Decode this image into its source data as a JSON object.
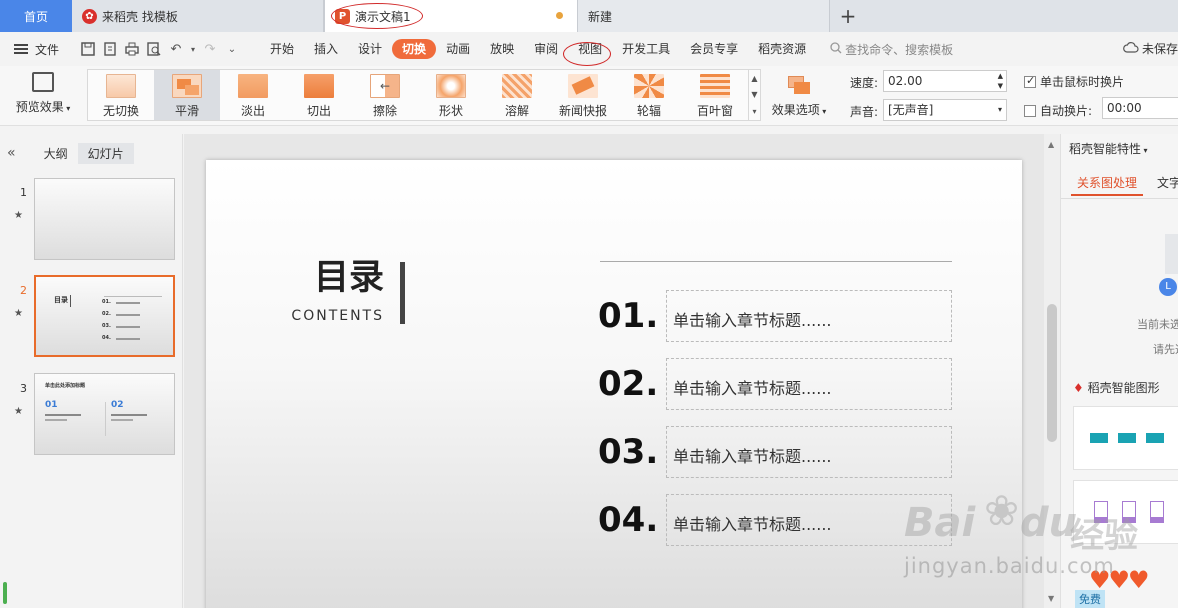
{
  "tabs": {
    "home": "首页",
    "template": "来稻壳 找模板",
    "doc": "演示文稿1",
    "new": "新建",
    "add": "+"
  },
  "menu": {
    "file": "文件",
    "items": [
      "开始",
      "插入",
      "设计",
      "切换",
      "动画",
      "放映",
      "审阅",
      "视图",
      "开发工具",
      "会员专享",
      "稻壳资源"
    ],
    "search": "查找命令、搜索模板",
    "unsaved": "未保存"
  },
  "ribbon": {
    "preview": "预览效果",
    "effects": [
      {
        "label": "无切换"
      },
      {
        "label": "平滑"
      },
      {
        "label": "淡出"
      },
      {
        "label": "切出"
      },
      {
        "label": "擦除"
      },
      {
        "label": "形状"
      },
      {
        "label": "溶解"
      },
      {
        "label": "新闻快报"
      },
      {
        "label": "轮辐"
      },
      {
        "label": "百叶窗"
      }
    ],
    "effect_options": "效果选项",
    "speed_label": "速度:",
    "speed_value": "02.00",
    "sound_label": "声音:",
    "sound_value": "[无声音]",
    "on_click": "单击鼠标时换片",
    "auto": "自动换片:",
    "auto_value": "00:00"
  },
  "left_panel": {
    "tab_outline": "大纲",
    "tab_slides": "幻灯片",
    "collapse": "«",
    "slides": [
      {
        "num": "1"
      },
      {
        "num": "2",
        "title": "目录",
        "items": [
          "01.",
          "02.",
          "03.",
          "04."
        ]
      },
      {
        "num": "3",
        "title": "单击此处添加标题",
        "items": [
          "01",
          "02"
        ]
      }
    ]
  },
  "slide": {
    "title": "目录",
    "subtitle": "CONTENTS",
    "chapters": [
      {
        "num": "01.",
        "text": "单击输入章节标题......"
      },
      {
        "num": "02.",
        "text": "单击输入章节标题......"
      },
      {
        "num": "03.",
        "text": "单击输入章节标题......"
      },
      {
        "num": "04.",
        "text": "单击输入章节标题......"
      }
    ]
  },
  "right_panel": {
    "header": "稻壳智能特性",
    "tab_relation": "关系图处理",
    "tab_text": "文字",
    "note1": "当前未选",
    "note2": "请先选",
    "section": "稻壳智能图形",
    "free": "免费"
  },
  "watermark": {
    "brand": "Bai",
    "brand2": "du",
    "cn": "经验",
    "url": "jingyan.baidu.com"
  },
  "colors": {
    "accent": "#f06b3b",
    "home_tab": "#4a86e8",
    "annotation": "#d12a2a"
  }
}
